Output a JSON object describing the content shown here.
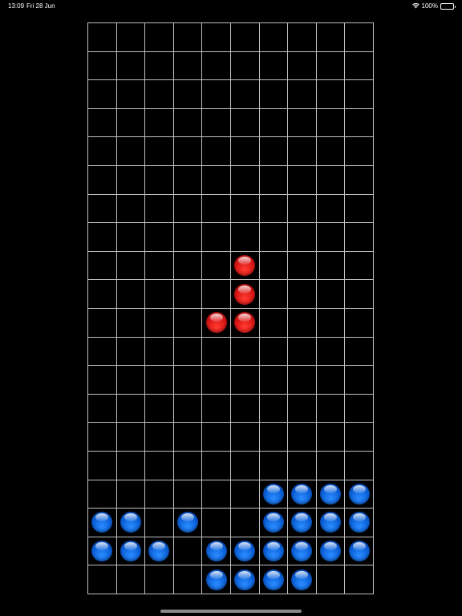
{
  "status_bar": {
    "time": "13:09",
    "date": "Fri 28 Jun",
    "battery": "100%"
  },
  "board": {
    "columns": 10,
    "rows": 20,
    "grid_color": "#bfbfbf",
    "background": "#000000",
    "falling_piece": {
      "color": "red",
      "cells": [
        [
          8,
          5
        ],
        [
          9,
          5
        ],
        [
          10,
          4
        ],
        [
          10,
          5
        ]
      ]
    },
    "settled": {
      "color": "blue",
      "cells": [
        [
          16,
          6
        ],
        [
          16,
          7
        ],
        [
          16,
          8
        ],
        [
          16,
          9
        ],
        [
          17,
          0
        ],
        [
          17,
          1
        ],
        [
          17,
          3
        ],
        [
          17,
          6
        ],
        [
          17,
          7
        ],
        [
          17,
          8
        ],
        [
          17,
          9
        ],
        [
          18,
          0
        ],
        [
          18,
          1
        ],
        [
          18,
          2
        ],
        [
          18,
          4
        ],
        [
          18,
          5
        ],
        [
          18,
          6
        ],
        [
          18,
          7
        ],
        [
          18,
          8
        ],
        [
          18,
          9
        ],
        [
          19,
          4
        ],
        [
          19,
          5
        ],
        [
          19,
          6
        ],
        [
          19,
          7
        ]
      ]
    }
  },
  "colors": {
    "red": "#d81414",
    "blue": "#0a5fd8"
  }
}
